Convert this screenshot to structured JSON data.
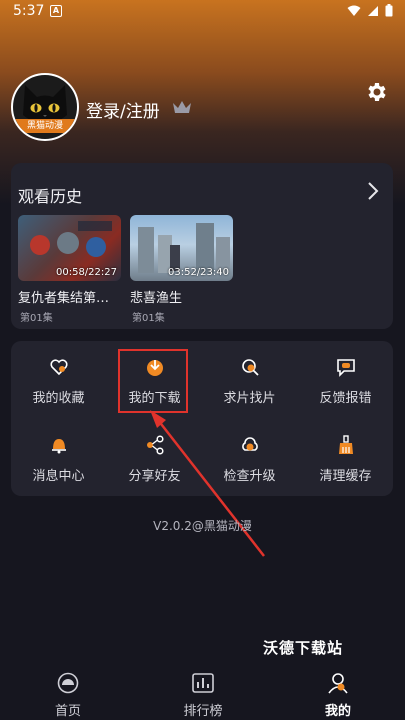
{
  "status": {
    "time": "5:37",
    "notif_glyph": "A"
  },
  "profile": {
    "login_label": "登录/注册",
    "avatar_band": "黑猫动漫"
  },
  "history": {
    "title": "观看历史",
    "items": [
      {
        "time": "00:58/22:27",
        "title": "复仇者集结第…",
        "episode": "第01集"
      },
      {
        "time": "03:52/23:40",
        "title": "悲喜渔生",
        "episode": "第01集"
      }
    ]
  },
  "menu": {
    "items": [
      {
        "label": "我的收藏",
        "icon": "heart-icon"
      },
      {
        "label": "我的下载",
        "icon": "download-icon"
      },
      {
        "label": "求片找片",
        "icon": "search-film-icon"
      },
      {
        "label": "反馈报错",
        "icon": "feedback-icon"
      },
      {
        "label": "消息中心",
        "icon": "bell-icon"
      },
      {
        "label": "分享好友",
        "icon": "share-icon"
      },
      {
        "label": "检查升级",
        "icon": "upgrade-icon"
      },
      {
        "label": "清理缓存",
        "icon": "broom-icon"
      }
    ]
  },
  "version": "V2.0.2@黑猫动漫",
  "watermark": "沃德下载站",
  "tabs": [
    {
      "label": "首页",
      "icon": "home-icon",
      "active": false
    },
    {
      "label": "排行榜",
      "icon": "ranking-icon",
      "active": false
    },
    {
      "label": "我的",
      "icon": "profile-icon",
      "active": true
    }
  ],
  "colors": {
    "accent": "#f08a24",
    "highlight": "#e0332c",
    "card": "#23232e",
    "background": "#16161f"
  }
}
